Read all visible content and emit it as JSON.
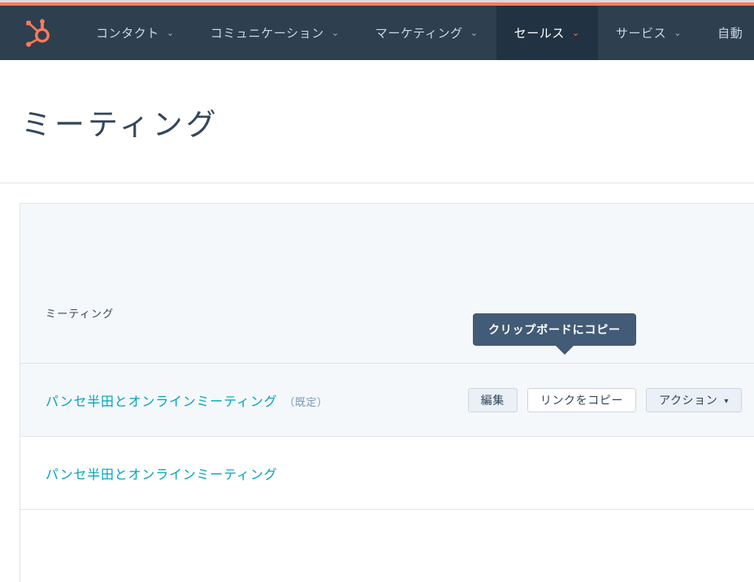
{
  "brand": {
    "logo_icon": "hubspot-sprocket-icon",
    "accent_color": "#ff7a59",
    "nav_background": "#2e3f50",
    "link_color": "#00a4bd",
    "tooltip_color": "#425b76"
  },
  "nav": {
    "items": [
      {
        "label": "コンタクト",
        "caret": "⌄",
        "active": false
      },
      {
        "label": "コミュニケーション",
        "caret": "⌄",
        "active": false
      },
      {
        "label": "マーケティング",
        "caret": "⌄",
        "active": false
      },
      {
        "label": "セールス",
        "caret": "⌄",
        "active": true
      },
      {
        "label": "サービス",
        "caret": "⌄",
        "active": false
      },
      {
        "label": "自動",
        "caret": "",
        "active": false
      }
    ]
  },
  "page": {
    "title": "ミーティング"
  },
  "card": {
    "header_label": "ミーティング",
    "rows": [
      {
        "link": "パンセ半田とオンラインミーティング",
        "suffix": "（既定）",
        "highlighted": true,
        "actions": [
          {
            "label": "編集",
            "caret": "",
            "hovered": false
          },
          {
            "label": "リンクをコピー",
            "caret": "",
            "hovered": true
          },
          {
            "label": "アクション",
            "caret": "▾",
            "hovered": false
          }
        ],
        "tooltip": "クリップボードにコピー"
      },
      {
        "link": "パンセ半田とオンラインミーティング",
        "suffix": "",
        "highlighted": false,
        "actions": [],
        "tooltip": ""
      }
    ]
  }
}
